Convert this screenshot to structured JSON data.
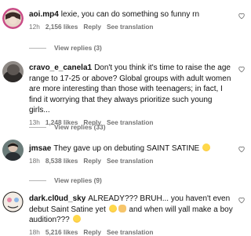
{
  "comments": [
    {
      "username": "aoi.mp4",
      "text": "lexie, you can do something so funny rn",
      "time": "12h",
      "likes": "2,156 likes",
      "reply_label": "Reply",
      "translation_label": "See translation",
      "replies_label": "View replies (3)"
    },
    {
      "username": "cravo_e_canela1",
      "text": "Don't you think it's time to raise the age range to 17-25 or above? Global groups with adult women are more interesting than those with teenagers; in fact, I find it worrying that they always prioritize such young girls...",
      "time": "13h",
      "likes": "1,248 likes",
      "reply_label": "Reply",
      "translation_label": "See translation",
      "replies_label": "View replies (33)"
    },
    {
      "username": "jmsae",
      "text": "They gave up on debuting SAINT SATINE",
      "time": "18h",
      "likes": "8,538 likes",
      "reply_label": "Reply",
      "translation_label": "See translation",
      "replies_label": "View replies (9)"
    },
    {
      "username": "dark.cl0ud_sky",
      "text_a": "ALREADY??? BRUH... you haven't even debut Saint Satine yet",
      "text_b": "and when will yall make a boy audition???",
      "time": "18h",
      "likes": "5,216 likes",
      "reply_label": "Reply",
      "translation_label": "See translation"
    }
  ],
  "colors": {
    "text": "#111111",
    "meta": "#737373",
    "divider": "#b5b5b5"
  },
  "icons": {
    "like": "heart-outline-icon",
    "emoji_1": "laughing-face-emoji",
    "emoji_2": "crying-face-emoji",
    "emoji_3": "hand-emoji"
  }
}
